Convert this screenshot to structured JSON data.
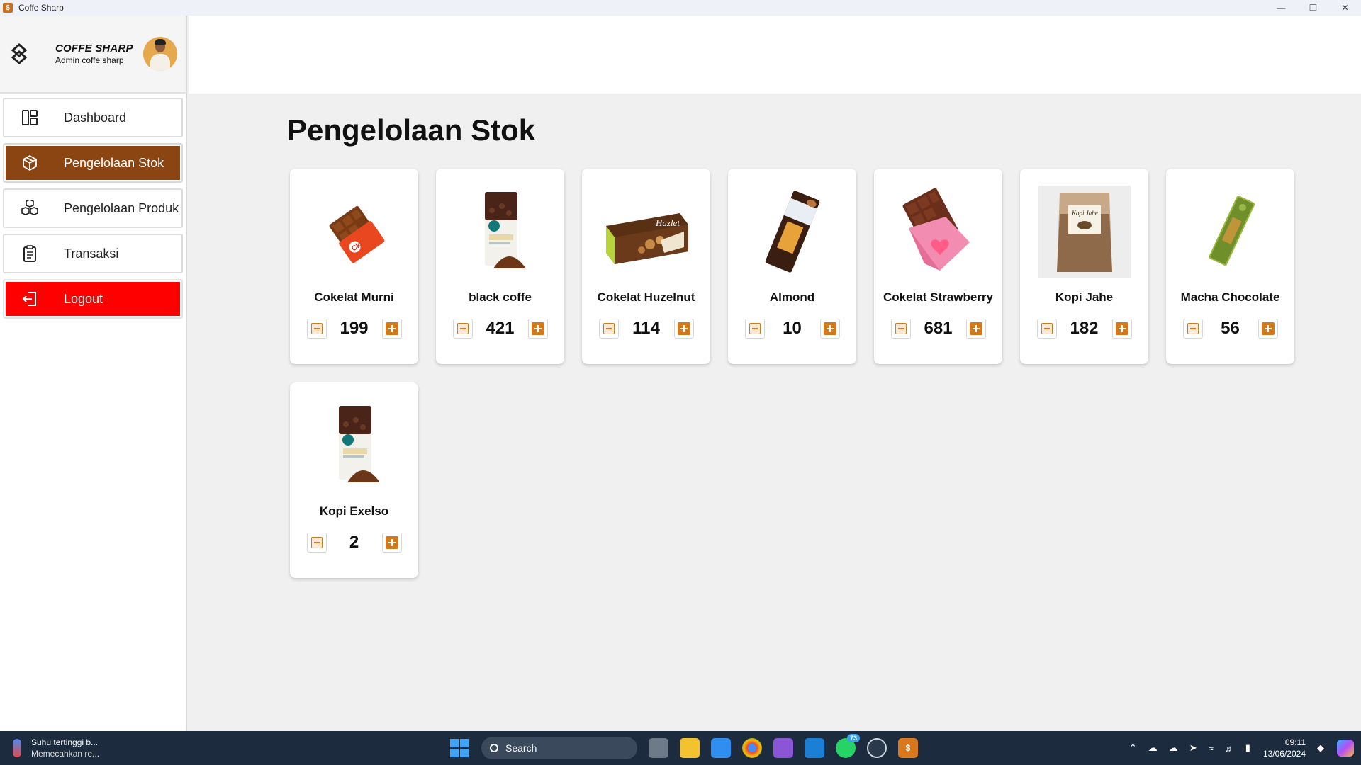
{
  "window": {
    "title": "Coffe Sharp"
  },
  "profile": {
    "name": "COFFE SHARP",
    "role": "Admin coffe sharp"
  },
  "nav": [
    {
      "label": "Dashboard",
      "icon": "dashboard-icon"
    },
    {
      "label": "Pengelolaan Stok",
      "icon": "box-icon",
      "active": true
    },
    {
      "label": "Pengelolaan Produk",
      "icon": "boxes-icon"
    },
    {
      "label": "Transaksi",
      "icon": "clipboard-icon"
    },
    {
      "label": "Logout",
      "icon": "logout-icon"
    }
  ],
  "page": {
    "title": "Pengelolaan Stok"
  },
  "products": [
    {
      "name": "Cokelat Murni",
      "qty": "199",
      "image": "chocolate-bar-red"
    },
    {
      "name": "black coffe",
      "qty": "421",
      "image": "coffee-bag"
    },
    {
      "name": "Cokelat Huzelnut",
      "qty": "114",
      "image": "hazelnut-box"
    },
    {
      "name": "Almond",
      "qty": "10",
      "image": "almond-bar"
    },
    {
      "name": "Cokelat Strawberry",
      "qty": "681",
      "image": "strawberry-bar"
    },
    {
      "name": "Kopi Jahe",
      "qty": "182",
      "image": "ginger-coffee-pouch"
    },
    {
      "name": "Macha Chocolate",
      "qty": "56",
      "image": "matcha-bar"
    },
    {
      "name": "Kopi Exelso",
      "qty": "2",
      "image": "coffee-bag"
    }
  ],
  "colors": {
    "accent": "#8b4513",
    "logout": "#ff0000",
    "button": "#d27a1b"
  },
  "taskbar": {
    "weather_title": "Suhu tertinggi b...",
    "weather_sub": "Memecahkan re...",
    "search_label": "Search",
    "whatsapp_badge": "73",
    "time": "09:11",
    "date": "13/06/2024"
  }
}
